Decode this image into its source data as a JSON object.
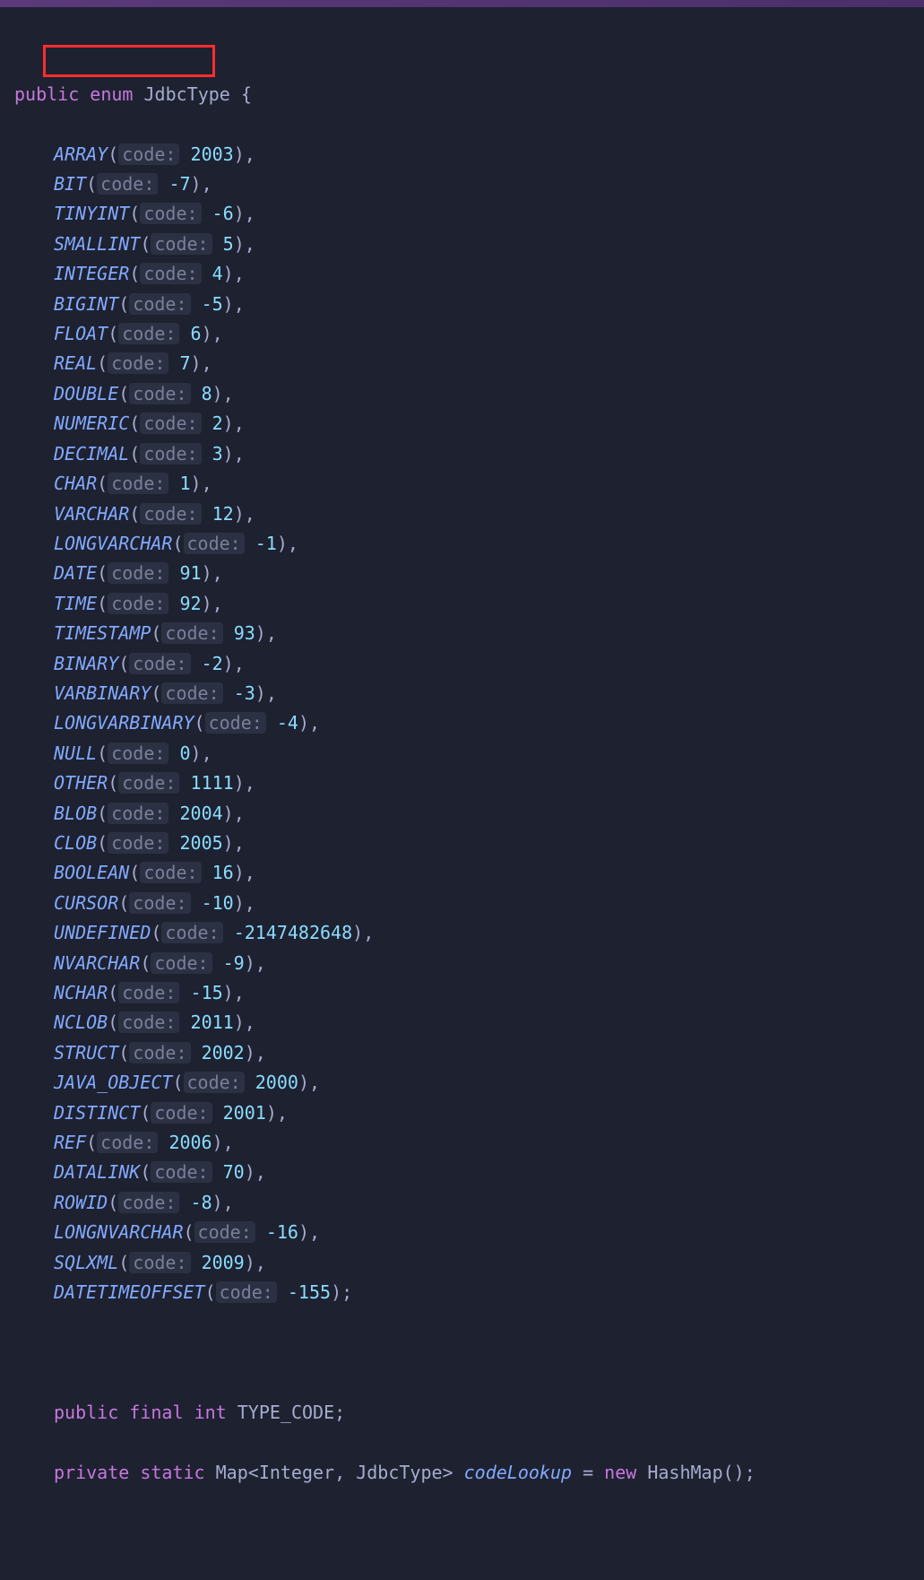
{
  "header": {
    "decl_public": "public",
    "decl_enum": "enum",
    "decl_name": "JdbcType",
    "brace_open": "{"
  },
  "code_label": "code:",
  "enums": [
    {
      "name": "ARRAY",
      "value": "2003",
      "term": ","
    },
    {
      "name": "BIT",
      "value": "-7",
      "term": ","
    },
    {
      "name": "TINYINT",
      "value": "-6",
      "term": ","
    },
    {
      "name": "SMALLINT",
      "value": "5",
      "term": ","
    },
    {
      "name": "INTEGER",
      "value": "4",
      "term": ","
    },
    {
      "name": "BIGINT",
      "value": "-5",
      "term": ","
    },
    {
      "name": "FLOAT",
      "value": "6",
      "term": ","
    },
    {
      "name": "REAL",
      "value": "7",
      "term": ","
    },
    {
      "name": "DOUBLE",
      "value": "8",
      "term": ","
    },
    {
      "name": "NUMERIC",
      "value": "2",
      "term": ","
    },
    {
      "name": "DECIMAL",
      "value": "3",
      "term": ","
    },
    {
      "name": "CHAR",
      "value": "1",
      "term": ","
    },
    {
      "name": "VARCHAR",
      "value": "12",
      "term": ","
    },
    {
      "name": "LONGVARCHAR",
      "value": "-1",
      "term": ","
    },
    {
      "name": "DATE",
      "value": "91",
      "term": ","
    },
    {
      "name": "TIME",
      "value": "92",
      "term": ","
    },
    {
      "name": "TIMESTAMP",
      "value": "93",
      "term": ","
    },
    {
      "name": "BINARY",
      "value": "-2",
      "term": ","
    },
    {
      "name": "VARBINARY",
      "value": "-3",
      "term": ","
    },
    {
      "name": "LONGVARBINARY",
      "value": "-4",
      "term": ","
    },
    {
      "name": "NULL",
      "value": "0",
      "term": ","
    },
    {
      "name": "OTHER",
      "value": "1111",
      "term": ","
    },
    {
      "name": "BLOB",
      "value": "2004",
      "term": ","
    },
    {
      "name": "CLOB",
      "value": "2005",
      "term": ","
    },
    {
      "name": "BOOLEAN",
      "value": "16",
      "term": ","
    },
    {
      "name": "CURSOR",
      "value": "-10",
      "term": ","
    },
    {
      "name": "UNDEFINED",
      "value": "-2147482648",
      "term": ","
    },
    {
      "name": "NVARCHAR",
      "value": "-9",
      "term": ","
    },
    {
      "name": "NCHAR",
      "value": "-15",
      "term": ","
    },
    {
      "name": "NCLOB",
      "value": "2011",
      "term": ","
    },
    {
      "name": "STRUCT",
      "value": "2002",
      "term": ","
    },
    {
      "name": "JAVA_OBJECT",
      "value": "2000",
      "term": ","
    },
    {
      "name": "DISTINCT",
      "value": "2001",
      "term": ","
    },
    {
      "name": "REF",
      "value": "2006",
      "term": ","
    },
    {
      "name": "DATALINK",
      "value": "70",
      "term": ","
    },
    {
      "name": "ROWID",
      "value": "-8",
      "term": ","
    },
    {
      "name": "LONGNVARCHAR",
      "value": "-16",
      "term": ","
    },
    {
      "name": "SQLXML",
      "value": "2009",
      "term": ","
    },
    {
      "name": "DATETIMEOFFSET",
      "value": "-155",
      "term": ";"
    }
  ],
  "members": {
    "line1": {
      "public": "public",
      "final": "final",
      "int": "int",
      "name": "TYPE_CODE",
      "semi": ";"
    },
    "line2": {
      "private": "private",
      "static": "static",
      "type_map": "Map",
      "lt": "<",
      "type_integer": "Integer",
      "comma": ", ",
      "type_jdbc": "JdbcType",
      "gt": ">",
      "field": "codeLookup",
      "eq": " = ",
      "new": "new",
      "ctor": "HashMap",
      "parens": "()",
      "semi": ";"
    }
  }
}
